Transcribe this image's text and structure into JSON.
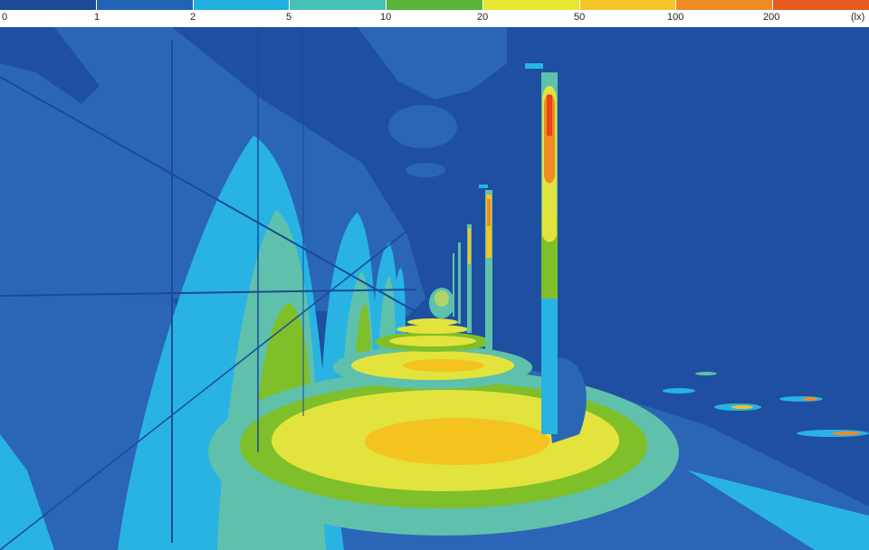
{
  "legend": {
    "colors": [
      "#1a4a98",
      "#2163b5",
      "#1fb0e0",
      "#45c2b5",
      "#5ab43a",
      "#e8e630",
      "#f5c528",
      "#f08a24",
      "#e85a1f"
    ],
    "ticks": [
      "0",
      "1",
      "2",
      "5",
      "10",
      "20",
      "50",
      "100",
      "200",
      "(lx)"
    ]
  },
  "palette": {
    "background": "#1e4fa0",
    "level_1": "#2b66b6",
    "level_2": "#28b3e3",
    "level_5": "#5fc1ac",
    "level_10": "#7fbf2a",
    "level_20": "#e2e33d",
    "level_50": "#f4c31f",
    "level_100": "#f08a24",
    "level_200": "#e3451c"
  }
}
